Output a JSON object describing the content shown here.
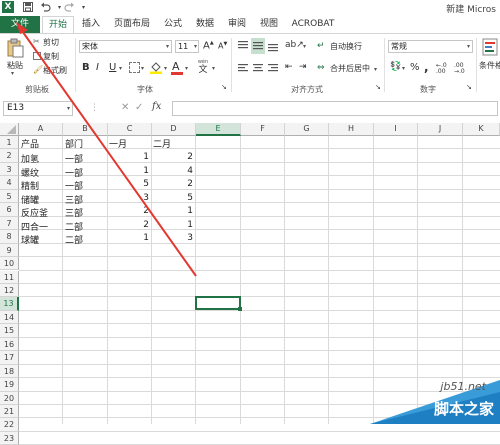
{
  "titlebar": {
    "logo": "X",
    "save_icon": "save-icon",
    "undo_icon": "undo-icon",
    "redo_icon": "redo-icon",
    "doc_title": "新建 Micros"
  },
  "tabs": [
    {
      "label": "文件"
    },
    {
      "label": "开始"
    },
    {
      "label": "插入"
    },
    {
      "label": "页面布局"
    },
    {
      "label": "公式"
    },
    {
      "label": "数据"
    },
    {
      "label": "审阅"
    },
    {
      "label": "视图"
    },
    {
      "label": "ACROBAT"
    }
  ],
  "ribbon": {
    "clipboard": {
      "paste": "粘贴",
      "cut": "剪切",
      "copy": "复制",
      "format_painter": "格式刷",
      "group_label": "剪贴板"
    },
    "font": {
      "font_name": "宋体",
      "font_size": "11",
      "bold": "B",
      "italic": "I",
      "underline": "U",
      "font_color_letter": "A",
      "wen": "wén",
      "wen_char": "文",
      "group_label": "字体"
    },
    "alignment": {
      "wrap_text": "自动换行",
      "merge_center": "合并后居中",
      "group_label": "对齐方式"
    },
    "number": {
      "format": "常规",
      "percent": "%",
      "comma": ",",
      "group_label": "数字"
    },
    "styles": {
      "conditional_format": "条件格"
    }
  },
  "formula_bar": {
    "name_box": "E13",
    "fx": "fx",
    "cancel_icon": "✕",
    "enter_icon": "✓"
  },
  "columns": [
    "A",
    "B",
    "C",
    "D",
    "E",
    "F",
    "G",
    "H",
    "I",
    "J",
    "K"
  ],
  "rows": [
    "1",
    "2",
    "3",
    "4",
    "5",
    "6",
    "7",
    "8",
    "9",
    "10",
    "11",
    "12",
    "13",
    "14",
    "15",
    "16",
    "17",
    "18",
    "19",
    "20",
    "21",
    "22",
    "23"
  ],
  "cells": {
    "row1": {
      "a": "产品",
      "b": "部门",
      "c": "一月",
      "d": "二月"
    },
    "row2": {
      "a": "加氢",
      "b": "一部",
      "c": "1",
      "d": "2"
    },
    "row3": {
      "a": "螺纹",
      "b": "一部",
      "c": "1",
      "d": "4"
    },
    "row4": {
      "a": "精制",
      "b": "一部",
      "c": "5",
      "d": "2"
    },
    "row5": {
      "a": "储罐",
      "b": "三部",
      "c": "3",
      "d": "5"
    },
    "row6": {
      "a": "反应釜",
      "b": "三部",
      "c": "2",
      "d": "1"
    },
    "row7": {
      "a": "四合一",
      "b": "二部",
      "c": "2",
      "d": "1"
    },
    "row8": {
      "a": "球罐",
      "b": "二部",
      "c": "1",
      "d": "3"
    }
  },
  "active_cell": "E13",
  "watermark": {
    "site": "jb51.net",
    "name": "脚本之家"
  },
  "colors": {
    "excel_green": "#217346",
    "annotation_arrow": "#e2382f"
  }
}
